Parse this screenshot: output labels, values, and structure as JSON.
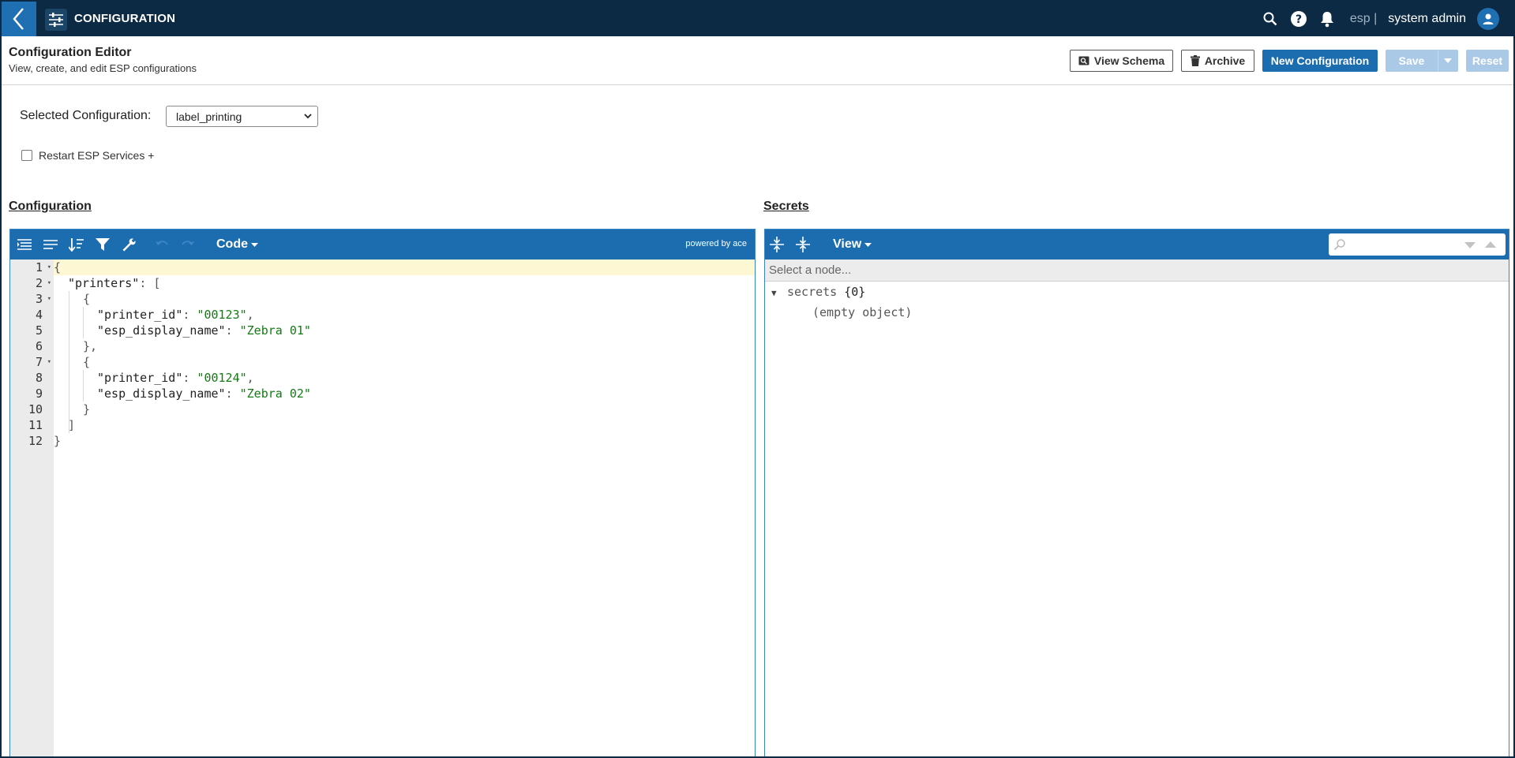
{
  "app": {
    "title": "CONFIGURATION"
  },
  "nav": {
    "tenant": "esp |",
    "user": "system admin"
  },
  "header": {
    "title": "Configuration Editor",
    "subtitle": "View, create, and edit ESP configurations",
    "buttons": {
      "view_schema": "View Schema",
      "archive": "Archive",
      "new_configuration": "New Configuration",
      "save": "Save",
      "reset": "Reset"
    }
  },
  "selector": {
    "label": "Selected Configuration:",
    "value": "label_printing"
  },
  "restart": {
    "label": "Restart ESP Services +",
    "checked": false
  },
  "configuration_panel": {
    "title": "Configuration",
    "mode": "Code",
    "powered_by": "powered by ace",
    "lines": [
      {
        "n": "1",
        "fold": true
      },
      {
        "n": "2",
        "fold": true
      },
      {
        "n": "3",
        "fold": true
      },
      {
        "n": "4",
        "fold": false
      },
      {
        "n": "5",
        "fold": false
      },
      {
        "n": "6",
        "fold": false
      },
      {
        "n": "7",
        "fold": true
      },
      {
        "n": "8",
        "fold": false
      },
      {
        "n": "9",
        "fold": false
      },
      {
        "n": "10",
        "fold": false
      },
      {
        "n": "11",
        "fold": false
      },
      {
        "n": "12",
        "fold": false
      }
    ],
    "code": {
      "open_brace": "{",
      "printers_key": "\"printers\"",
      "colon": ": ",
      "open_bracket": "[",
      "obj_open": "{",
      "printer_id_key": "\"printer_id\"",
      "printer_id_1": "\"00123\"",
      "comma": ",",
      "esp_display_name_key": "\"esp_display_name\"",
      "display_name_1": "\"Zebra 01\"",
      "obj_close_comma": "},",
      "printer_id_2": "\"00124\"",
      "display_name_2": "\"Zebra 02\"",
      "obj_close": "}",
      "close_bracket": "]",
      "close_brace": "}"
    }
  },
  "secrets_panel": {
    "title": "Secrets",
    "mode": "View",
    "node_placeholder": "Select a node...",
    "tree": {
      "root_key": "secrets",
      "root_count": "{0}",
      "empty_label": "(empty object)"
    }
  },
  "colors": {
    "nav_bg": "#0c2a44",
    "accent": "#1b6db0",
    "string": "#157a15"
  }
}
